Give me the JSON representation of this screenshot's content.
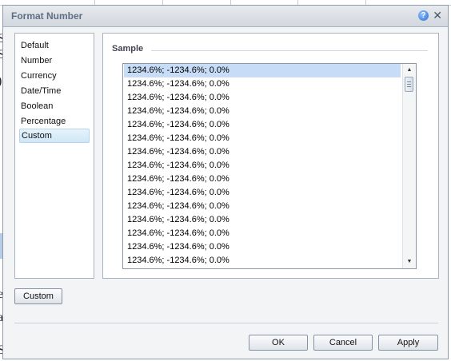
{
  "dialog": {
    "title": "Format Number"
  },
  "background": {
    "glyphs": [
      "S",
      "S",
      ")",
      "e",
      "a",
      "S"
    ]
  },
  "categories": [
    {
      "label": "Default"
    },
    {
      "label": "Number"
    },
    {
      "label": "Currency"
    },
    {
      "label": "Date/Time"
    },
    {
      "label": "Boolean"
    },
    {
      "label": "Percentage"
    },
    {
      "label": "Custom",
      "selected": true
    }
  ],
  "sample": {
    "label": "Sample",
    "rows": [
      "1234.6%; -1234.6%; 0.0%",
      "1234.6%; -1234.6%; 0.0%",
      "1234.6%; -1234.6%; 0.0%",
      "1234.6%; -1234.6%; 0.0%",
      "1234.6%; -1234.6%; 0.0%",
      "1234.6%; -1234.6%; 0.0%",
      "1234.6%; -1234.6%; 0.0%",
      "1234.6%; -1234.6%; 0.0%",
      "1234.6%; -1234.6%; 0.0%",
      "1234.6%; -1234.6%; 0.0%",
      "1234.6%; -1234.6%; 0.0%",
      "1234.6%; -1234.6%; 0.0%",
      "1234.6%; -1234.6%; 0.0%",
      "1234.6%; -1234.6%; 0.0%",
      "1234.6%; -1234.6%; 0.0%"
    ]
  },
  "buttons": {
    "custom": "Custom",
    "ok": "OK",
    "cancel": "Cancel",
    "apply": "Apply"
  },
  "icons": {
    "help": "?",
    "close": "✕",
    "scroll_up": "▲",
    "scroll_down": "▼"
  }
}
